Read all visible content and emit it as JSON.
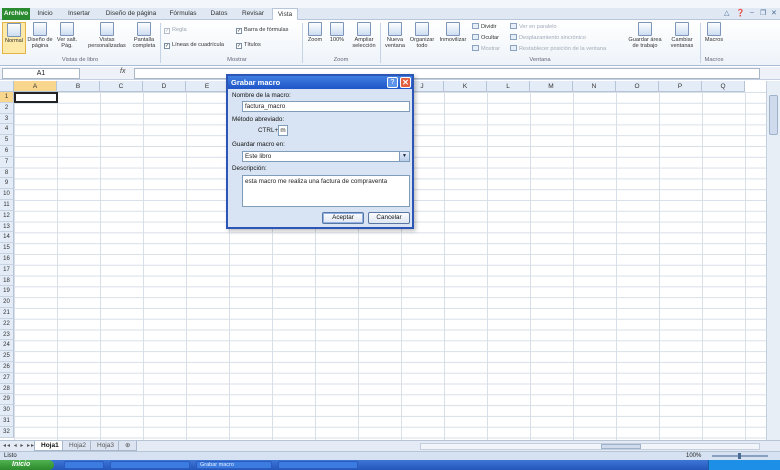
{
  "ribbon_tabs": [
    {
      "label": "Archivo"
    },
    {
      "label": "Inicio"
    },
    {
      "label": "Insertar"
    },
    {
      "label": "Diseño de página"
    },
    {
      "label": "Fórmulas"
    },
    {
      "label": "Datos"
    },
    {
      "label": "Revisar"
    },
    {
      "label": "Vista"
    }
  ],
  "active_tab": "Vista",
  "ribbon": {
    "vistas_libro": {
      "group_label": "Vistas de libro",
      "normal": "Normal",
      "diseno_pagina": "Diseño de página",
      "ver_salt": "Ver salt. Pág.",
      "vistas_personalizadas": "Vistas personalizadas",
      "pantalla_completa": "Pantalla completa"
    },
    "mostrar": {
      "group_label": "Mostrar",
      "regla": "Regla",
      "barra_formulas": "Barra de fórmulas",
      "lineas_cuadricula": "Líneas de cuadrícula",
      "titulos": "Títulos"
    },
    "zoom": {
      "group_label": "Zoom",
      "zoom": "Zoom",
      "cien": "100%",
      "ampliar": "Ampliar selección"
    },
    "ventana": {
      "group_label": "Ventana",
      "nueva_ventana": "Nueva ventana",
      "organizar_todo": "Organizar todo",
      "inmovilizar": "Inmovilizar",
      "dividir": "Dividir",
      "ocultar": "Ocultar",
      "mostrar": "Mostrar",
      "ver_en_paralelo": "Ver en paralelo",
      "desplazamiento_sincronico": "Desplazamiento sincrónico",
      "restablecer_posicion": "Restablecer posición de la ventana",
      "guardar_area": "Guardar área de trabajo",
      "cambiar_ventanas": "Cambiar ventanas"
    },
    "macros": {
      "group_label": "Macros",
      "macros": "Macros"
    }
  },
  "formula_bar": {
    "name_box": "A1",
    "fx": "fx",
    "value": ""
  },
  "columns": [
    "A",
    "B",
    "C",
    "D",
    "E",
    "F",
    "G",
    "H",
    "I",
    "J",
    "K",
    "L",
    "M",
    "N",
    "O",
    "P",
    "Q"
  ],
  "rows": [
    "1",
    "2",
    "3",
    "4",
    "5",
    "6",
    "7",
    "8",
    "9",
    "10",
    "11",
    "12",
    "13",
    "14",
    "15",
    "16",
    "17",
    "18",
    "19",
    "20",
    "21",
    "22",
    "23",
    "24",
    "25",
    "26",
    "27",
    "28",
    "29",
    "30",
    "31",
    "32"
  ],
  "active_cell": "A1",
  "sheets": [
    {
      "label": "Hoja1",
      "active": true
    },
    {
      "label": "Hoja2",
      "active": false
    },
    {
      "label": "Hoja3",
      "active": false
    }
  ],
  "status": {
    "ready": "Listo",
    "zoom": "100%"
  },
  "taskbar": {
    "start": "Inicio",
    "items": [
      "",
      "",
      "Grabar macro",
      ""
    ]
  },
  "dialog": {
    "title": "Grabar macro",
    "help": "?",
    "close": "✕",
    "name_label": "Nombre de la macro:",
    "name_value": "factura_macro",
    "shortcut_label": "Método abreviado:",
    "shortcut_prefix": "CTRL+",
    "shortcut_value": "m",
    "store_label": "Guardar macro en:",
    "store_value": "Este libro",
    "desc_label": "Descripción:",
    "desc_value": "esta macro me realiza una factura de compraventa",
    "ok": "Aceptar",
    "cancel": "Cancelar"
  },
  "colors": {
    "file_tab": "#2a8a2f",
    "dialog_border": "#2b55b6",
    "selection_header": "#f8d68d",
    "taskbar": "#2456b8"
  }
}
